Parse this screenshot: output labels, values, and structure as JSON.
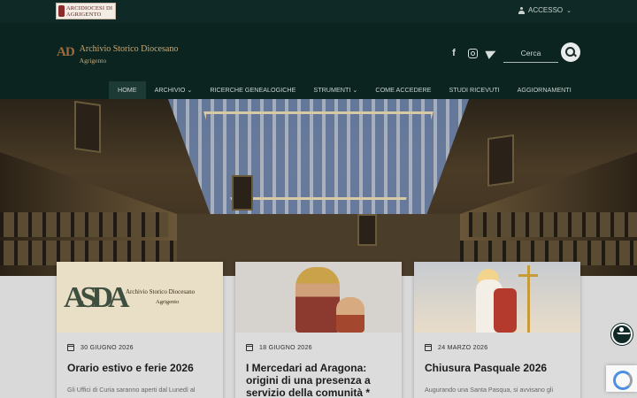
{
  "topbar": {
    "diocesi_logo_text": "ARCIDIOCESI DI AGRIGENTO",
    "account_label": "ACCESSO"
  },
  "header": {
    "brand_mark": "AD",
    "brand_title": "Archivio Storico Diocesano",
    "brand_subtitle": "Agrigento",
    "socials": [
      "facebook-icon",
      "instagram-icon",
      "telegram-icon"
    ],
    "search_placeholder": "Cerca"
  },
  "nav": {
    "items": [
      {
        "label": "HOME",
        "active": true
      },
      {
        "label": "ARCHIVIO",
        "dropdown": true
      },
      {
        "label": "RICERCHE GENEALOGICHE"
      },
      {
        "label": "STRUMENTI",
        "dropdown": true
      },
      {
        "label": "COME ACCEDERE"
      },
      {
        "label": "STUDI RICEVUTI"
      },
      {
        "label": "AGGIORNAMENTI"
      }
    ]
  },
  "cards": [
    {
      "image_logo_mark": "ASDA",
      "image_logo_title": "Archivio Storico Diocesano",
      "image_logo_sub": "Agrigento",
      "date": "30 GIUGNO 2026",
      "title": "Orario estivo e ferie 2026",
      "excerpt": "Gli Uffici di Curia saranno aperti dal Lunedì al"
    },
    {
      "date": "18 GIUGNO 2026",
      "title": "I Mercedari ad Aragona: origini di una presenza a servizio della comunità *",
      "excerpt": ""
    },
    {
      "date": "24 MARZO 2026",
      "title": "Chiusura Pasquale 2026",
      "excerpt": "Augurando una Santa Pasqua, si avvisano gli"
    }
  ],
  "colors": {
    "topbar_bg": "#0f2a26",
    "header_bg": "#0b2420",
    "brand_gold": "#c9a977"
  }
}
